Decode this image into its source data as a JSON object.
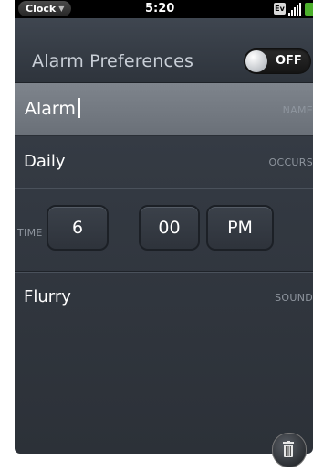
{
  "status_bar": {
    "app_menu_label": "Clock",
    "time": "5:20",
    "network_badge": "Ev"
  },
  "header": {
    "title": "Alarm Preferences",
    "toggle_state": "OFF"
  },
  "fields": {
    "name": {
      "value": "Alarm",
      "label": "NAME"
    },
    "occurs": {
      "value": "Daily",
      "label": "OCCURS"
    },
    "time": {
      "label": "TIME",
      "hour": "6",
      "minute": "00",
      "meridiem": "PM"
    },
    "sound": {
      "value": "Flurry",
      "label": "SOUND"
    }
  },
  "icons": {
    "menu_caret": "chevron-down-icon",
    "signal": "signal-bars-icon",
    "battery": "battery-icon",
    "delete": "trash-icon"
  },
  "colors": {
    "battery_green": "#4caf2c",
    "selected_row": "#7e848c",
    "background": "#343a43"
  }
}
